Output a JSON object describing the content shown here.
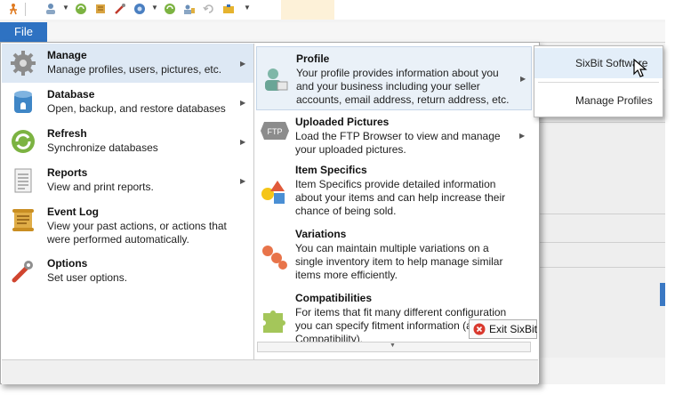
{
  "file_tab": {
    "label": "File"
  },
  "file_menu": {
    "left_items": [
      {
        "title": "Manage",
        "desc": "Manage profiles, users, pictures, etc.",
        "icon": "gear-icon",
        "has_arrow": true,
        "active": true
      },
      {
        "title": "Database",
        "desc": "Open, backup, and restore databases",
        "icon": "database-icon",
        "has_arrow": true
      },
      {
        "title": "Refresh",
        "desc": "Synchronize databases",
        "icon": "refresh-icon",
        "has_arrow": true
      },
      {
        "title": "Reports",
        "desc": "View and print reports.",
        "icon": "report-icon",
        "has_arrow": true
      },
      {
        "title": "Event Log",
        "desc": "View your past actions, or actions that were performed automatically.",
        "icon": "scroll-icon",
        "has_arrow": false
      },
      {
        "title": "Options",
        "desc": "Set user options.",
        "icon": "tools-icon",
        "has_arrow": false
      }
    ],
    "right_items": [
      {
        "title": "Profile",
        "desc": "Your profile provides information about you and your business including your seller accounts, email address, return address, etc.",
        "icon": "profile-icon",
        "has_arrow": true,
        "active": true
      },
      {
        "title": "Uploaded Pictures",
        "desc": "Load the FTP Browser to view and manage your uploaded pictures.",
        "icon": "ftp-icon",
        "icon_text": "FTP",
        "has_arrow": true
      },
      {
        "title": "Item Specifics",
        "desc": "Item Specifics provide detailed information about your items and can help increase their chance of being sold.",
        "icon": "shapes-icon",
        "has_arrow": false
      },
      {
        "title": "Variations",
        "desc": "You can maintain multiple variations on a single inventory item to help manage similar items more efficiently.",
        "icon": "variations-icon",
        "has_arrow": false
      },
      {
        "title": "Compatibilities",
        "desc": "For items that fit many different configuration you can specify fitment information (aka Parts Compatibility).",
        "icon": "puzzle-icon",
        "has_arrow": false
      }
    ],
    "exit_label": "Exit SixBit"
  },
  "submenu": {
    "items": [
      {
        "label": "SixBit Software",
        "hover": true
      },
      {
        "label": "Manage Profiles"
      }
    ]
  },
  "colors": {
    "accent": "#2e72c2",
    "active_bg": "#dde8f4",
    "exit_red": "#d9392e"
  }
}
